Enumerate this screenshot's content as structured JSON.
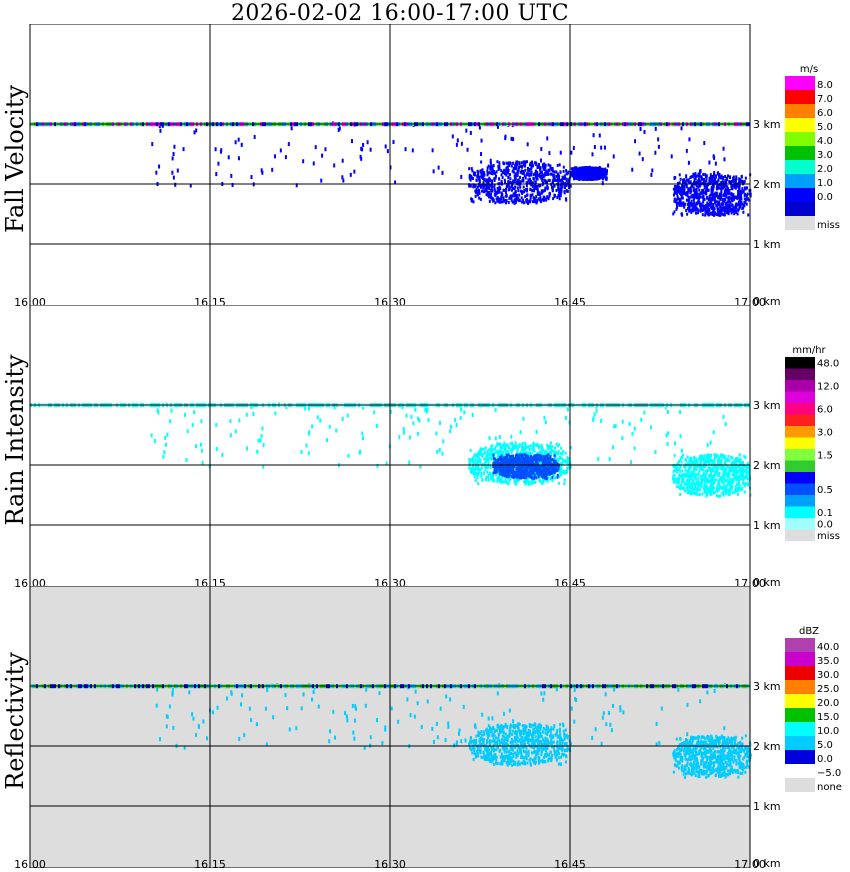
{
  "title": "2026-02-02   16:00-17:00 UTC",
  "time_ticks": [
    "16:00",
    "16:15",
    "16:30",
    "16:45",
    "17:00"
  ],
  "height_ticks": [
    "0 km",
    "1 km",
    "2 km",
    "3 km"
  ],
  "chart_data": [
    {
      "type": "heatmap",
      "panel": "fall_velocity",
      "ylabel": "Fall Velocity",
      "units": "m/s",
      "x_range": [
        "16:00",
        "17:00"
      ],
      "y_range_km": [
        0,
        3.3
      ],
      "grid": true,
      "legend_position": "right",
      "legend": [
        {
          "label": "8.0",
          "color": "#ff00ff"
        },
        {
          "label": "7.0",
          "color": "#ff0000"
        },
        {
          "label": "6.0",
          "color": "#ff8000"
        },
        {
          "label": "5.0",
          "color": "#ffff00"
        },
        {
          "label": "4.0",
          "color": "#80ff00"
        },
        {
          "label": "3.0",
          "color": "#00c000"
        },
        {
          "label": "2.0",
          "color": "#00ffcc"
        },
        {
          "label": "1.0",
          "color": "#00a0ff"
        },
        {
          "label": "0.0",
          "color": "#0000ff"
        },
        {
          "label": "",
          "color": "#0000d0"
        },
        {
          "label": "miss",
          "color": "#dddddd"
        }
      ],
      "background": "#ffffff",
      "noise_row_colors": [
        "#33cc33",
        "#66ee66",
        "#0000ff",
        "#00a0ff",
        "#ff00ff"
      ],
      "echoes": [
        {
          "t0": 36.5,
          "t1": 45.0,
          "h0": 1.7,
          "h1": 2.4,
          "color": "#0000ff"
        },
        {
          "t0": 53.5,
          "t1": 60.0,
          "h0": 1.5,
          "h1": 2.2,
          "color": "#0000ff"
        },
        {
          "t0": 45.0,
          "t1": 48.0,
          "h0": 2.1,
          "h1": 2.3,
          "color": "#0000ff"
        }
      ]
    },
    {
      "type": "heatmap",
      "panel": "rain_intensity",
      "ylabel": "Rain Intensity",
      "units": "mm/hr",
      "x_range": [
        "16:00",
        "17:00"
      ],
      "y_range_km": [
        0,
        3.3
      ],
      "grid": true,
      "legend_position": "right",
      "legend": [
        {
          "label": "48.0",
          "color": "#000000"
        },
        {
          "label": "",
          "color": "#660066"
        },
        {
          "label": "12.0",
          "color": "#aa00aa"
        },
        {
          "label": "",
          "color": "#dd00dd"
        },
        {
          "label": "6.0",
          "color": "#ff0080"
        },
        {
          "label": "",
          "color": "#ff2020"
        },
        {
          "label": "3.0",
          "color": "#ff9900"
        },
        {
          "label": "",
          "color": "#ffff00"
        },
        {
          "label": "1.5",
          "color": "#80ff40"
        },
        {
          "label": "",
          "color": "#30cc30"
        },
        {
          "label": "",
          "color": "#0000ff"
        },
        {
          "label": "0.5",
          "color": "#0050ff"
        },
        {
          "label": "",
          "color": "#00a0ff"
        },
        {
          "label": "0.1",
          "color": "#00ffff"
        },
        {
          "label": "0.0",
          "color": "#a0ffff"
        },
        {
          "label": "miss",
          "color": "#dddddd"
        }
      ],
      "background": "#ffffff",
      "noise_row_colors": [
        "#00ffff",
        "#40e0e0",
        "#a0ffff"
      ],
      "echoes": [
        {
          "t0": 36.5,
          "t1": 45.0,
          "h0": 1.7,
          "h1": 2.4,
          "color": "#00ffff"
        },
        {
          "t0": 38.5,
          "t1": 44.0,
          "h0": 1.8,
          "h1": 2.2,
          "color": "#0050ff"
        },
        {
          "t0": 53.5,
          "t1": 60.0,
          "h0": 1.5,
          "h1": 2.2,
          "color": "#00ffff"
        }
      ]
    },
    {
      "type": "heatmap",
      "panel": "reflectivity",
      "ylabel": "Reflectivity",
      "units": "dBZ",
      "x_range": [
        "16:00",
        "17:00"
      ],
      "y_range_km": [
        0,
        3.3
      ],
      "grid": true,
      "legend_position": "right",
      "legend": [
        {
          "label": "40.0",
          "color": "#b040b0"
        },
        {
          "label": "35.0",
          "color": "#cc00cc"
        },
        {
          "label": "30.0",
          "color": "#ee0000"
        },
        {
          "label": "25.0",
          "color": "#ff8000"
        },
        {
          "label": "20.0",
          "color": "#ffff00"
        },
        {
          "label": "15.0",
          "color": "#00c000"
        },
        {
          "label": "10.0",
          "color": "#00ffff"
        },
        {
          "label": "5.0",
          "color": "#00ccff"
        },
        {
          "label": "0.0",
          "color": "#0000dd"
        },
        {
          "label": "−5.0",
          "color": "#ffffff"
        },
        {
          "label": "none",
          "color": "#dddddd"
        }
      ],
      "background": "#dddddd",
      "noise_row_colors": [
        "#33cc33",
        "#66ee66",
        "#00ccff",
        "#0000dd"
      ],
      "echoes": [
        {
          "t0": 36.5,
          "t1": 45.0,
          "h0": 1.7,
          "h1": 2.4,
          "color": "#00ccff"
        },
        {
          "t0": 53.5,
          "t1": 60.0,
          "h0": 1.5,
          "h1": 2.2,
          "color": "#00ccff"
        }
      ]
    }
  ]
}
